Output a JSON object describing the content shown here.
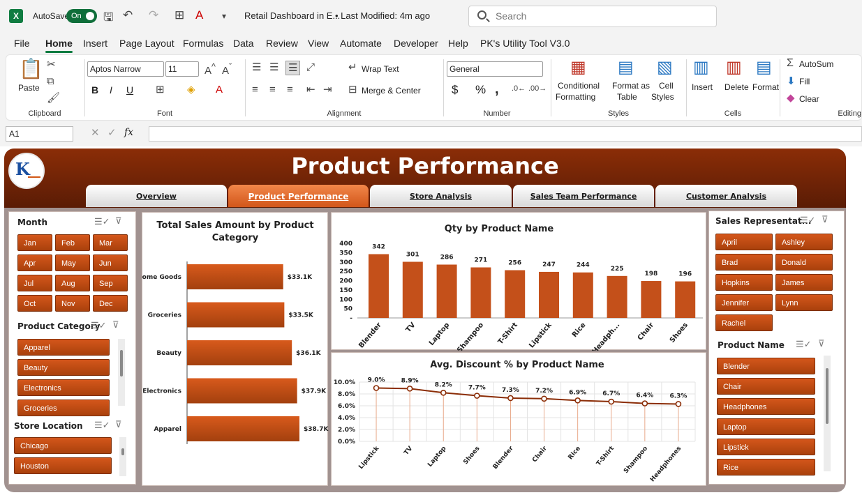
{
  "app": {
    "autosave_label": "AutoSave",
    "autosave_state": "On",
    "doc_title": "Retail Dashboard in E...",
    "last_modified": "• Last Modified: 4m ago",
    "search_placeholder": "Search"
  },
  "menu": [
    "File",
    "Home",
    "Insert",
    "Page Layout",
    "Formulas",
    "Data",
    "Review",
    "View",
    "Automate",
    "Developer",
    "Help",
    "PK's Utility Tool V3.0"
  ],
  "ribbon": {
    "clipboard": {
      "label": "Clipboard",
      "paste": "Paste"
    },
    "font": {
      "label": "Font",
      "name": "Aptos Narrow",
      "size": "11",
      "bold": "B",
      "italic": "I",
      "underline": "U"
    },
    "alignment": {
      "label": "Alignment",
      "wrap": "Wrap Text",
      "merge": "Merge & Center"
    },
    "number": {
      "label": "Number",
      "format": "General",
      "currency": "$",
      "percent": "%",
      "comma": ","
    },
    "styles": {
      "label": "Styles",
      "cond1": "Conditional",
      "cond2": "Formatting",
      "table1": "Format as",
      "table2": "Table",
      "cell1": "Cell",
      "cell2": "Styles"
    },
    "cells": {
      "label": "Cells",
      "insert": "Insert",
      "delete": "Delete",
      "format": "Format"
    },
    "editing": {
      "label": "Editing",
      "autosum": "AutoSum",
      "fill": "Fill",
      "clear": "Clear"
    }
  },
  "formula_bar": {
    "cell": "A1",
    "fx": "fx"
  },
  "dashboard": {
    "title": "Product Performance",
    "tabs": [
      "Overview",
      "Product Performance",
      "Store Analysis",
      "Sales Team Performance",
      "Customer Analysis"
    ],
    "month_slicer": {
      "title": "Month",
      "items": [
        "Jan",
        "Feb",
        "Mar",
        "Apr",
        "May",
        "Jun",
        "Jul",
        "Aug",
        "Sep",
        "Oct",
        "Nov",
        "Dec"
      ]
    },
    "category_slicer": {
      "title": "Product Category",
      "items": [
        "Apparel",
        "Beauty",
        "Electronics",
        "Groceries"
      ]
    },
    "store_slicer": {
      "title": "Store Location",
      "items": [
        "Chicago",
        "Houston"
      ]
    },
    "rep_slicer": {
      "title": "Sales Representat...",
      "items": [
        "April",
        "Ashley",
        "Brad",
        "Donald",
        "Hopkins",
        "James",
        "Jennifer",
        "Lynn",
        "Rachel"
      ]
    },
    "product_slicer": {
      "title": "Product Name",
      "items": [
        "Blender",
        "Chair",
        "Headphones",
        "Laptop",
        "Lipstick",
        "Rice"
      ]
    }
  },
  "chart_data": [
    {
      "type": "bar",
      "orientation": "horizontal",
      "title": "Total Sales Amount by Product Category",
      "categories": [
        "Home Goods",
        "Groceries",
        "Beauty",
        "Electronics",
        "Apparel"
      ],
      "values": [
        33.1,
        33.5,
        36.1,
        37.9,
        38.7
      ],
      "labels": [
        "$33.1K",
        "$33.5K",
        "$36.1K",
        "$37.9K",
        "$38.7K"
      ],
      "unit": "K$",
      "color": "#c4501a"
    },
    {
      "type": "bar",
      "title": "Qty by Product Name",
      "categories": [
        "Blender",
        "TV",
        "Laptop",
        "Shampoo",
        "T-Shirt",
        "Lipstick",
        "Rice",
        "Headph...",
        "Chair",
        "Shoes"
      ],
      "values": [
        342,
        301,
        286,
        271,
        256,
        247,
        244,
        225,
        198,
        196
      ],
      "yticks": [
        "400",
        "350",
        "300",
        "250",
        "200",
        "150",
        "100",
        "50",
        "-"
      ],
      "ylim": [
        0,
        400
      ],
      "color": "#c4501a"
    },
    {
      "type": "line",
      "title": "Avg. Discount % by Product Name",
      "categories": [
        "Lipstick",
        "TV",
        "Laptop",
        "Shoes",
        "Blender",
        "Chair",
        "Rice",
        "T-Shirt",
        "Shampoo",
        "Headphones"
      ],
      "values": [
        9.0,
        8.9,
        8.2,
        7.7,
        7.3,
        7.2,
        6.9,
        6.7,
        6.4,
        6.3
      ],
      "labels": [
        "9.0%",
        "8.9%",
        "8.2%",
        "7.7%",
        "7.3%",
        "7.2%",
        "6.9%",
        "6.7%",
        "6.4%",
        "6.3%"
      ],
      "yticks": [
        "10.0%",
        "8.0%",
        "6.0%",
        "4.0%",
        "2.0%",
        "0.0%"
      ],
      "ylim": [
        0,
        10
      ],
      "color": "#8b2d07"
    }
  ]
}
